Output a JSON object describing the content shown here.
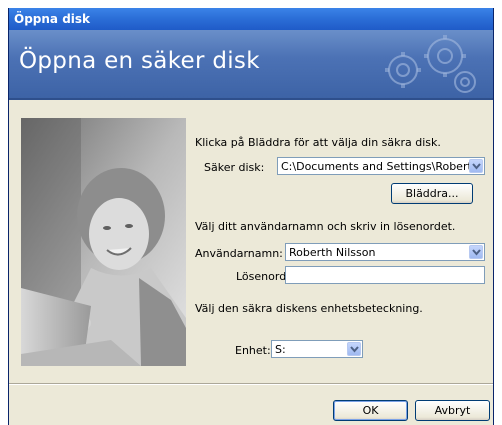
{
  "window": {
    "title": "Öppna disk"
  },
  "banner": {
    "heading": "Öppna en säker disk"
  },
  "form": {
    "intro_text": "Klicka på Bläddra för att välja din säkra disk.",
    "disk_label": "Säker disk:",
    "disk_value": "C:\\Documents and Settings\\Roberth",
    "browse_label": "Bläddra...",
    "user_intro": "Välj ditt användarnamn och skriv in lösenordet.",
    "username_label": "Användarnamn:",
    "username_value": "Roberth Nilsson",
    "password_label": "Lösenord:",
    "password_value": "",
    "drive_intro": "Välj den säkra diskens enhetsbeteckning.",
    "drive_label": "Enhet:",
    "drive_value": "S:"
  },
  "buttons": {
    "ok": "OK",
    "cancel": "Avbryt"
  },
  "colors": {
    "titlebar": "#2c6fd8",
    "banner": "#4c72b5",
    "dialog_bg": "#ece9d8"
  }
}
